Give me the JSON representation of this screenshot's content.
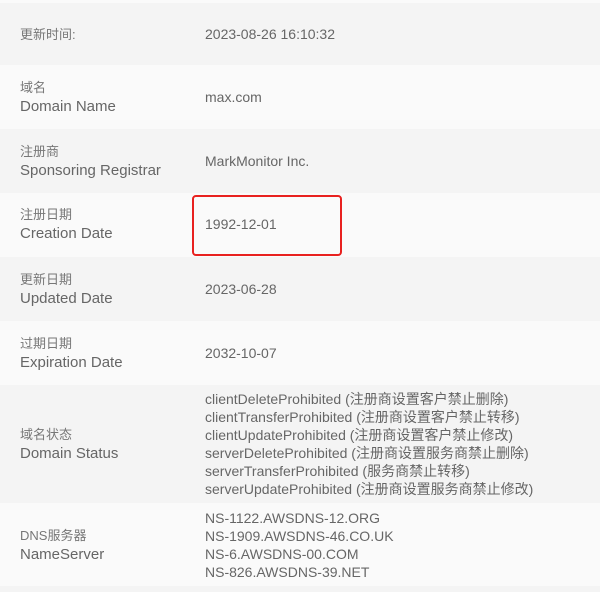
{
  "highlight_color": "#e8211f",
  "rows": [
    {
      "zh": "更新时间:",
      "en": "",
      "value": [
        "2023-08-26 16:10:32"
      ]
    },
    {
      "zh": "域名",
      "en": "Domain Name",
      "value": [
        "max.com"
      ]
    },
    {
      "zh": "注册商",
      "en": "Sponsoring Registrar",
      "value": [
        "MarkMonitor Inc."
      ]
    },
    {
      "zh": "注册日期",
      "en": "Creation Date",
      "value": [
        "1992-12-01"
      ]
    },
    {
      "zh": "更新日期",
      "en": "Updated Date",
      "value": [
        "2023-06-28"
      ]
    },
    {
      "zh": "过期日期",
      "en": "Expiration Date",
      "value": [
        "2032-10-07"
      ]
    },
    {
      "zh": "域名状态",
      "en": "Domain Status",
      "value": [
        "clientDeleteProhibited (注册商设置客户禁止删除)",
        "clientTransferProhibited (注册商设置客户禁止转移)",
        "clientUpdateProhibited (注册商设置客户禁止修改)",
        "serverDeleteProhibited (注册商设置服务商禁止删除)",
        "serverTransferProhibited (服务商禁止转移)",
        "serverUpdateProhibited (注册商设置服务商禁止修改)"
      ]
    },
    {
      "zh": "DNS服务器",
      "en": "NameServer",
      "value": [
        "NS-1122.AWSDNS-12.ORG",
        "NS-1909.AWSDNS-46.CO.UK",
        "NS-6.AWSDNS-00.COM",
        "NS-826.AWSDNS-39.NET"
      ]
    }
  ]
}
